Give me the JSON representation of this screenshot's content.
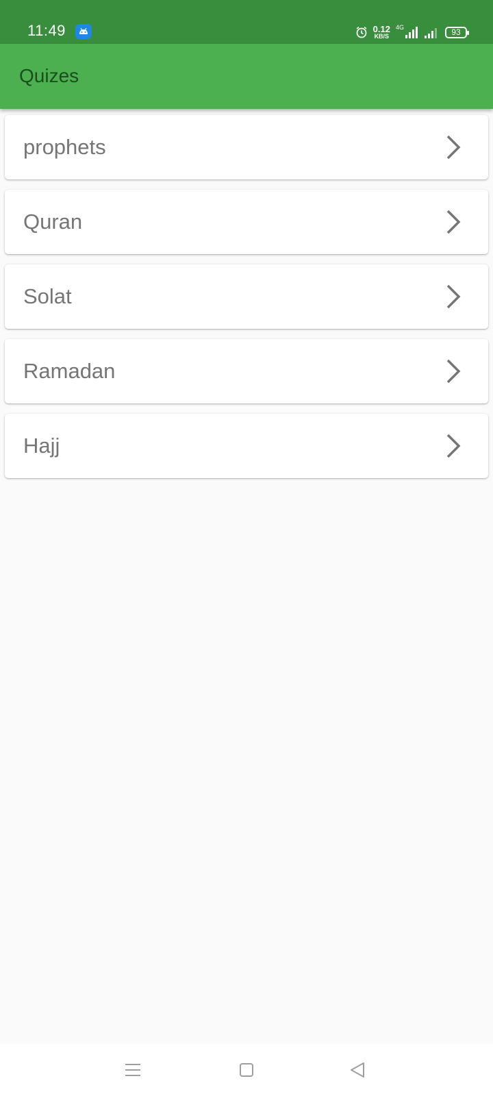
{
  "status_bar": {
    "time": "11:49",
    "net_speed_value": "0.12",
    "net_speed_unit": "KB/S",
    "network_type": "4G",
    "battery": "93"
  },
  "app_bar": {
    "title": "Quizes"
  },
  "quizzes": [
    {
      "label": "prophets"
    },
    {
      "label": "Quran"
    },
    {
      "label": "Solat"
    },
    {
      "label": "Ramadan"
    },
    {
      "label": "Hajj"
    }
  ],
  "nav_bar": {
    "buttons": [
      "menu-icon",
      "home-square-icon",
      "back-triangle-icon"
    ]
  },
  "colors": {
    "status_bar": "#388e3c",
    "app_bar": "#4caf50",
    "background": "#fafafa",
    "item_text": "#757575"
  }
}
